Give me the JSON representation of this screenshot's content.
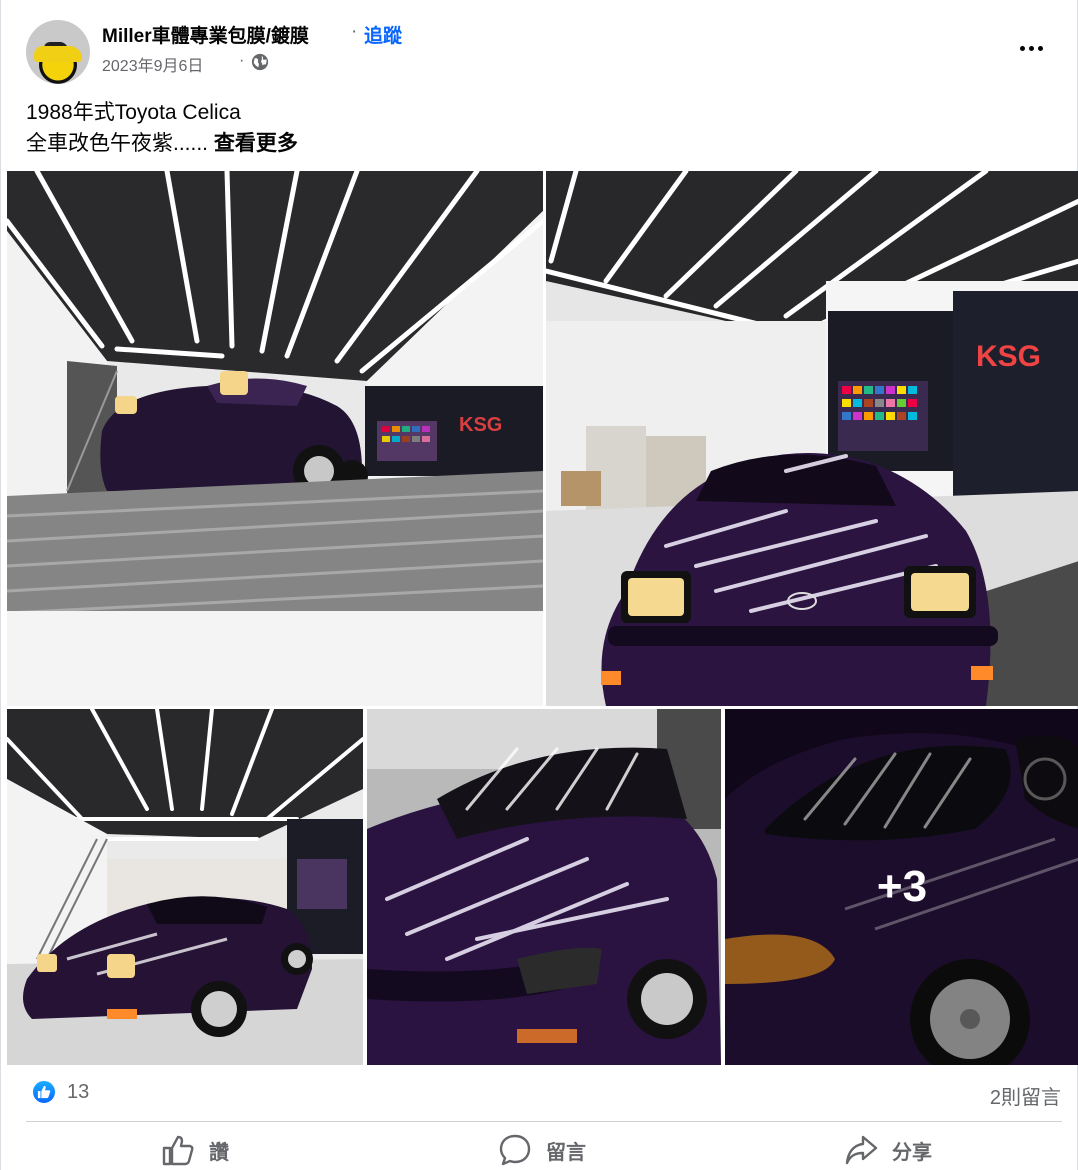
{
  "header": {
    "page_name": "Miller車體專業包膜/鍍膜",
    "separator": "·",
    "follow_label": "追蹤",
    "date": "2023年9月6日",
    "date_separator": "·",
    "privacy_icon": "globe-icon",
    "more_icon": "more-dots-icon"
  },
  "post": {
    "line1": "1988年式Toyota Celica",
    "line2": "全車改色午夜紫......",
    "see_more": "查看更多"
  },
  "photos": {
    "count": 5,
    "overflow_label": "+3"
  },
  "reactions": {
    "like_count": "13",
    "comments": "2則留言"
  },
  "actions": {
    "like_label": "讚",
    "comment_label": "留言",
    "share_label": "分享"
  },
  "colors": {
    "accent": "#0866ff",
    "secondary_text": "#65676b",
    "car_purple": "#2b1440"
  }
}
